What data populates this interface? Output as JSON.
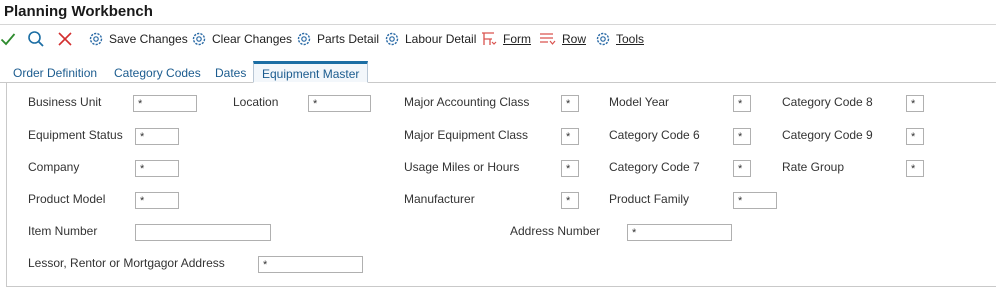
{
  "window": {
    "title": "Planning Workbench"
  },
  "toolbar": {
    "save_changes": "Save Changes",
    "clear_changes": "Clear Changes",
    "parts_detail": "Parts Detail",
    "labour_detail": "Labour Detail",
    "form": "Form",
    "row": "Row",
    "tools": "Tools"
  },
  "tabs": [
    "Order Definition",
    "Category Codes",
    "Dates",
    "Equipment Master"
  ],
  "active_tab": "Equipment Master",
  "fields": {
    "business_unit": {
      "label": "Business Unit",
      "value": "*"
    },
    "location": {
      "label": "Location",
      "value": "*"
    },
    "major_accounting_class": {
      "label": "Major Accounting Class",
      "value": "*"
    },
    "model_year": {
      "label": "Model Year",
      "value": "*"
    },
    "category_code_8": {
      "label": "Category Code 8",
      "value": "*"
    },
    "equipment_status": {
      "label": "Equipment Status",
      "value": "*"
    },
    "major_equipment_class": {
      "label": "Major Equipment Class",
      "value": "*"
    },
    "category_code_6": {
      "label": "Category Code 6",
      "value": "*"
    },
    "category_code_9": {
      "label": "Category Code 9",
      "value": "*"
    },
    "company": {
      "label": "Company",
      "value": "*"
    },
    "usage_miles_or_hours": {
      "label": "Usage Miles or Hours",
      "value": "*"
    },
    "category_code_7": {
      "label": "Category Code 7",
      "value": "*"
    },
    "rate_group": {
      "label": "Rate Group",
      "value": "*"
    },
    "product_model": {
      "label": "Product Model",
      "value": "*"
    },
    "manufacturer": {
      "label": "Manufacturer",
      "value": "*"
    },
    "product_family": {
      "label": "Product Family",
      "value": "*"
    },
    "item_number": {
      "label": "Item Number",
      "value": ""
    },
    "address_number": {
      "label": "Address Number",
      "value": "*"
    },
    "lessor_address": {
      "label": "Lessor, Rentor or Mortgagor Address",
      "value": "*"
    }
  },
  "colors": {
    "ok_check": "#2e8b2e",
    "cancel_x": "#d32f2f",
    "search": "#1c6ea4",
    "gear": "#2a6aa6",
    "menu_icon": "#d9534f",
    "tab_link": "#1c5c8f",
    "tab_accent": "#1c6ea4"
  },
  "icons": {
    "ok": "check-icon",
    "search": "search-icon",
    "cancel": "close-icon",
    "gear": "gear-icon",
    "form": "form-menu-icon",
    "row": "row-menu-icon"
  }
}
